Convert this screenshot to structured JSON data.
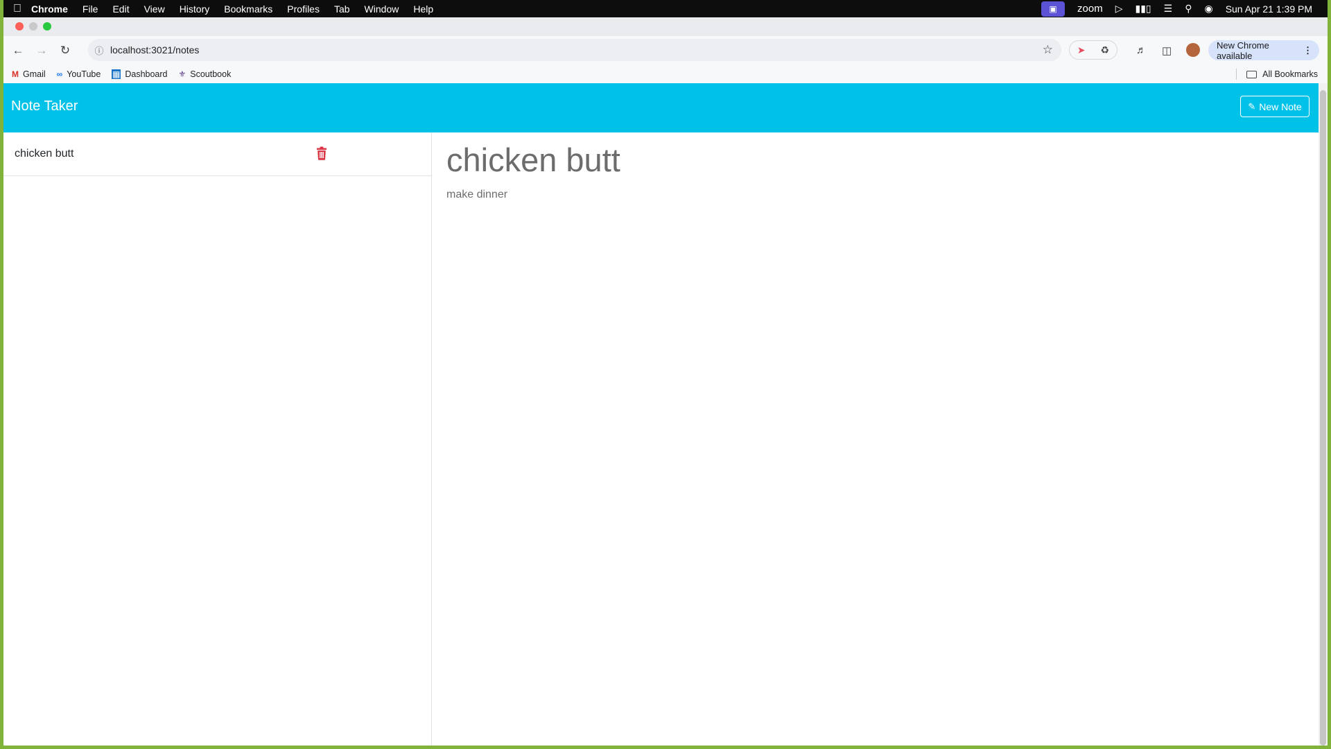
{
  "menubar": {
    "apple": "",
    "items": [
      "Chrome",
      "File",
      "Edit",
      "View",
      "History",
      "Bookmarks",
      "Profiles",
      "Tab",
      "Window",
      "Help"
    ],
    "zoom_label": "zoom",
    "datetime": "Sun Apr 21  1:39 PM"
  },
  "browser": {
    "url": "localhost:3021/notes",
    "update_label": "New Chrome available"
  },
  "bookmarks": {
    "items": [
      "Gmail",
      "YouTube",
      "Dashboard",
      "Scoutbook"
    ],
    "all_label": "All Bookmarks"
  },
  "app": {
    "brand": "Note Taker",
    "new_note_label": "New Note",
    "notes": [
      {
        "title": "chicken butt"
      }
    ],
    "active": {
      "title": "chicken butt",
      "body": "make dinner"
    },
    "colors": {
      "header": "#00c2e9",
      "delete": "#dc3545"
    }
  }
}
